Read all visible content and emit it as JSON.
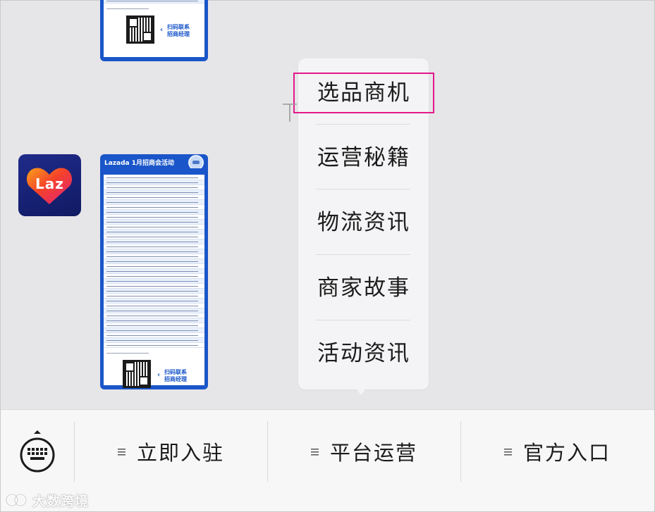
{
  "cards": {
    "main_title": "Lazada 1月招商会活动",
    "qr_caption_line1": "扫码联系",
    "qr_caption_line2": "招商经理",
    "top_qr_caption_line1": "扫码联系",
    "top_qr_caption_line2": "招商经理"
  },
  "avatar": {
    "brand_text": "Laz",
    "icon": "lazada-logo-icon",
    "colors": {
      "bg": "#101a63",
      "heart_start": "#f7431f",
      "heart_end": "#e3227d"
    }
  },
  "popup_menu": {
    "items": [
      {
        "label": "选品商机",
        "highlighted": true
      },
      {
        "label": "运营秘籍"
      },
      {
        "label": "物流资讯"
      },
      {
        "label": "商家故事"
      },
      {
        "label": "活动资讯"
      }
    ],
    "highlight_color": "#e4198a"
  },
  "bottom_bar": {
    "keyboard_icon": "keyboard-icon",
    "buttons": [
      {
        "label": "立即入驻",
        "icon": "menu-lines-icon"
      },
      {
        "label": "平台运营",
        "icon": "menu-lines-icon"
      },
      {
        "label": "官方入口",
        "icon": "menu-lines-icon"
      }
    ]
  },
  "watermark": {
    "text": "大数跨境"
  }
}
